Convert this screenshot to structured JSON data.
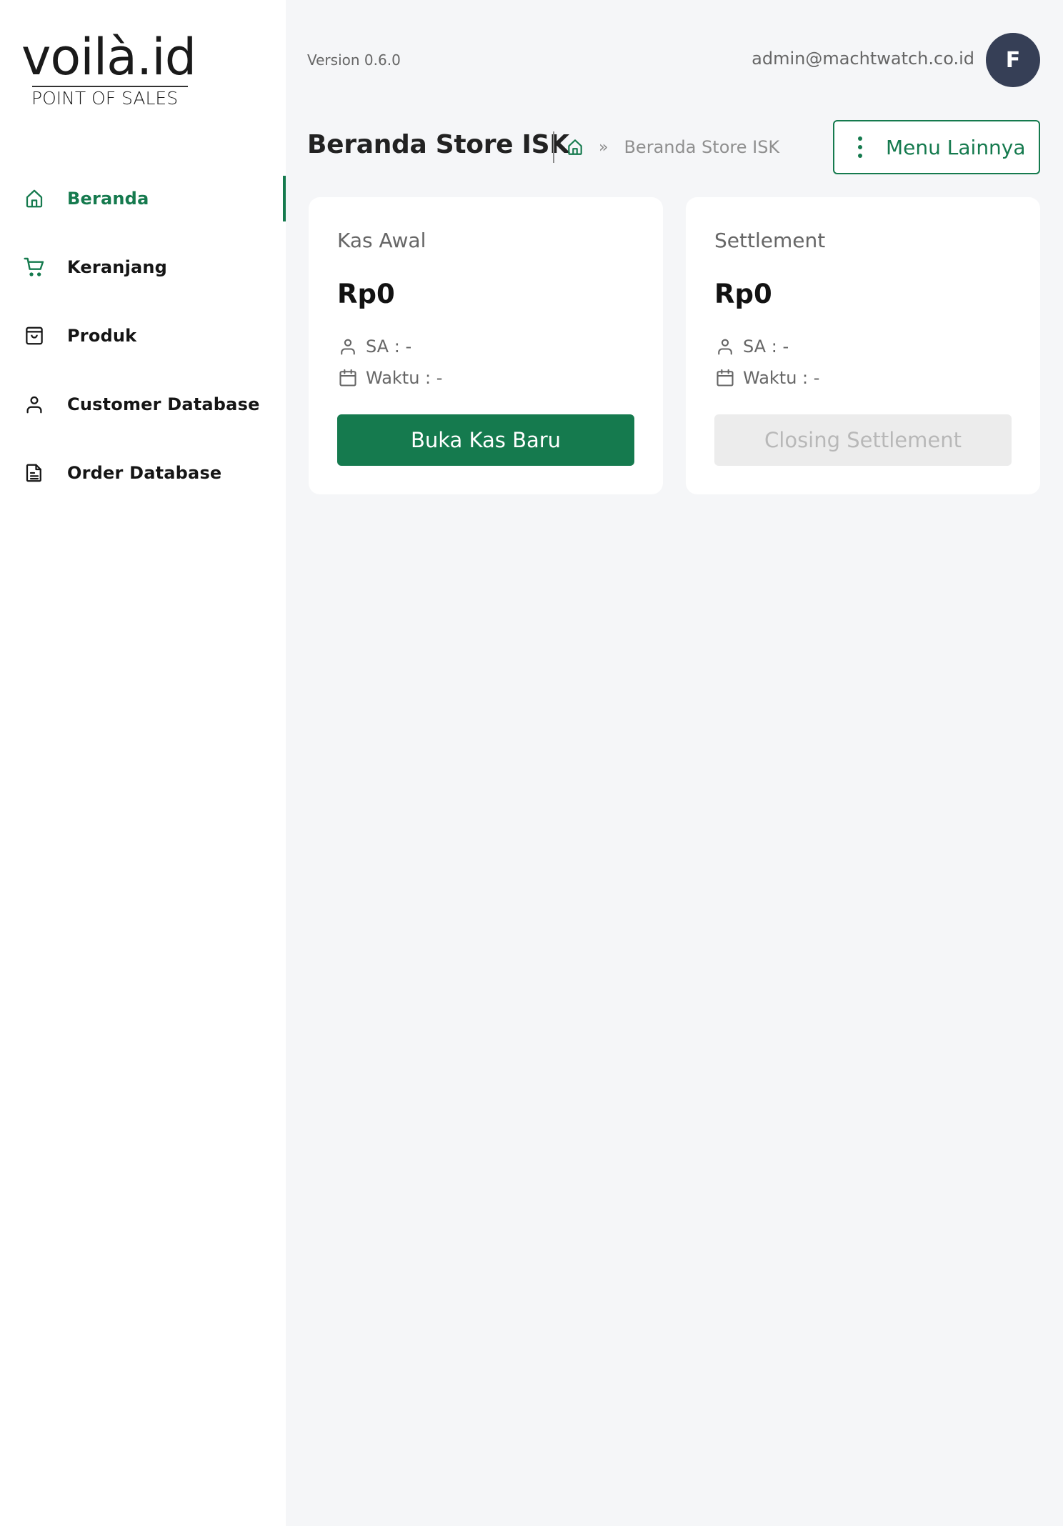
{
  "brand": {
    "logo_main": "voilà.id",
    "logo_sub": "POINT OF SALES"
  },
  "sidebar": {
    "items": [
      {
        "label": "Beranda",
        "icon": "home-icon",
        "active": true
      },
      {
        "label": "Keranjang",
        "icon": "cart-icon",
        "active": false
      },
      {
        "label": "Produk",
        "icon": "shopping-bag-icon",
        "active": false
      },
      {
        "label": "Customer Database",
        "icon": "user-icon",
        "active": false
      },
      {
        "label": "Order Database",
        "icon": "document-icon",
        "active": false
      }
    ]
  },
  "header": {
    "version": "Version 0.6.0",
    "user_email": "admin@machtwatch.co.id",
    "avatar_initial": "F"
  },
  "page": {
    "title": "Beranda Store ISK",
    "breadcrumb": {
      "separator": "»",
      "current": "Beranda Store ISK"
    },
    "menu_button_label": "Menu Lainnya"
  },
  "cards": {
    "kas_awal": {
      "title": "Kas Awal",
      "amount": "Rp0",
      "sa": "SA : -",
      "waktu": "Waktu : -",
      "action_label": "Buka Kas Baru",
      "action_enabled": true
    },
    "settlement": {
      "title": "Settlement",
      "amount": "Rp0",
      "sa": "SA : -",
      "waktu": "Waktu : -",
      "action_label": "Closing Settlement",
      "action_enabled": false
    }
  },
  "colors": {
    "accent": "#157a4e",
    "avatar_bg": "#363f56",
    "background": "#f5f6f8",
    "disabled_bg": "#ececec",
    "disabled_text": "#b8b8b8"
  }
}
